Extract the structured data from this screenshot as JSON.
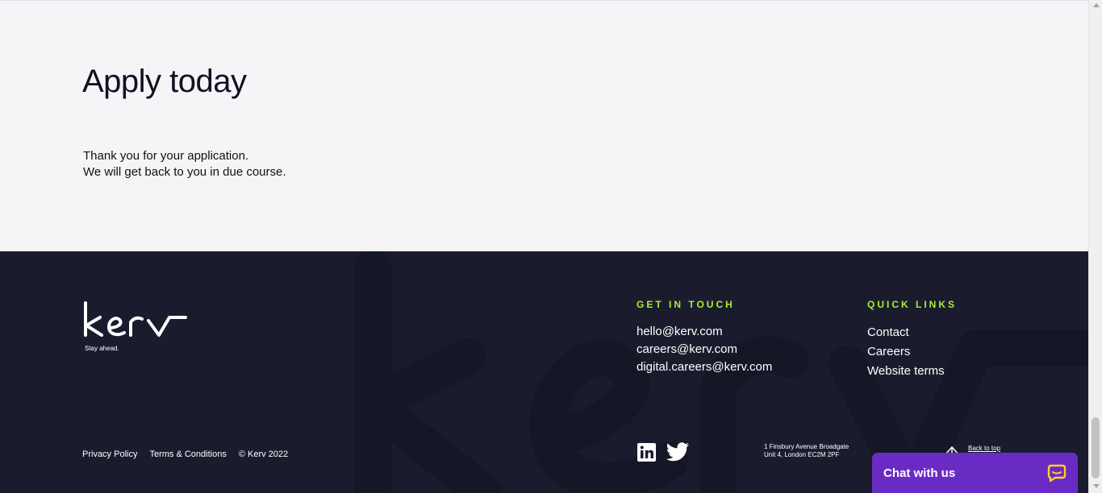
{
  "apply": {
    "title": "Apply today",
    "message_line1": "Thank you for your application.",
    "message_line2": "We will get back to you in due course."
  },
  "footer": {
    "tagline": "Stay ahead.",
    "get_in_touch": {
      "title": "GET IN TOUCH",
      "emails": [
        "hello@kerv.com",
        "careers@kerv.com",
        "digital.careers@kerv.com"
      ]
    },
    "quick_links": {
      "title": "QUICK LINKS",
      "items": [
        "Contact",
        "Careers",
        "Website terms"
      ]
    },
    "legal": {
      "privacy": "Privacy Policy",
      "terms": "Terms & Conditions",
      "copyright": "© Kerv 2022"
    },
    "address": {
      "line1": "1 Finsbury Avenue Broadgate",
      "line2": "Unit 4, London EC2M 2PF"
    },
    "back_to_top": "Back to top",
    "social_icons": [
      "linkedin-icon",
      "twitter-icon"
    ]
  },
  "chat": {
    "label": "Chat with us",
    "icon": "chat-bubble-icon"
  },
  "colors": {
    "footer_bg": "#1a1c2e",
    "accent_green": "#a8f02f",
    "chat_purple": "#6a2bc5",
    "page_bg": "#f6f4f7"
  }
}
